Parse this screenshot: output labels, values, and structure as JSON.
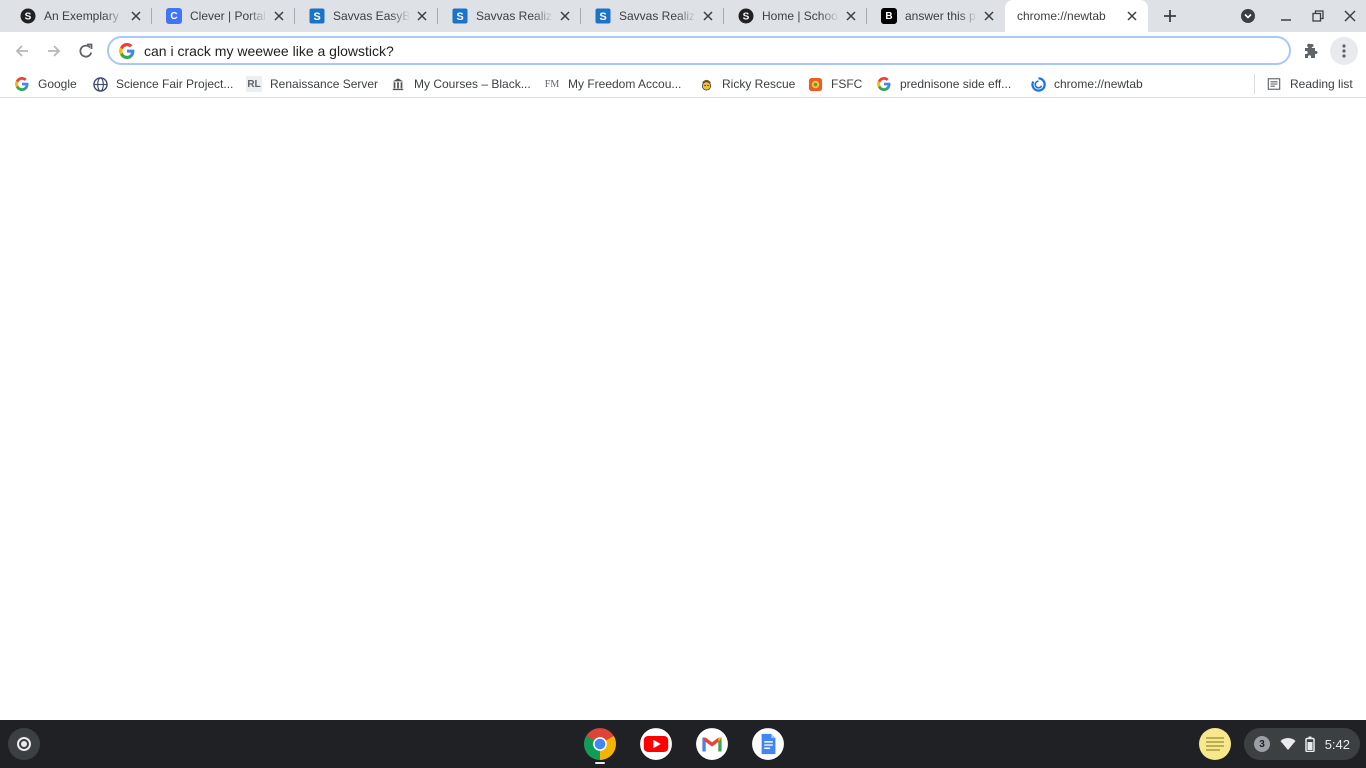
{
  "browser": {
    "tabs": [
      {
        "title": "An Exemplary",
        "favicon": "s-circle-icon"
      },
      {
        "title": "Clever | Portal",
        "favicon": "clever-c-icon"
      },
      {
        "title": "Savvas EasyBridge",
        "favicon": "savvas-s-icon"
      },
      {
        "title": "Savvas Realize",
        "favicon": "savvas-s-icon"
      },
      {
        "title": "Savvas Realize",
        "favicon": "savvas-s-icon"
      },
      {
        "title": "Home | Schoology",
        "favicon": "s-circle-icon"
      },
      {
        "title": "answer this ple",
        "favicon": "brainly-b-icon"
      },
      {
        "title": "chrome://newtab",
        "favicon": "none"
      }
    ],
    "active_tab_index": 7,
    "omnibox": {
      "value": "can i crack my weewee like a glowstick?"
    },
    "bookmarks": [
      {
        "label": "Google",
        "icon": "google-g-icon"
      },
      {
        "label": "Science Fair Project...",
        "icon": "globe-icon"
      },
      {
        "label": "Renaissance Server",
        "icon": "rl-icon"
      },
      {
        "label": "My Courses – Black...",
        "icon": "columns-icon"
      },
      {
        "label": "My Freedom Accou...",
        "icon": "fm-icon"
      },
      {
        "label": "Ricky Rescue",
        "icon": "ricky-icon"
      },
      {
        "label": "FSFC",
        "icon": "fsfc-icon"
      },
      {
        "label": "prednisone side eff...",
        "icon": "google-g-icon"
      },
      {
        "label": "chrome://newtab",
        "icon": "chrome-spinner-icon"
      }
    ],
    "reading_list": {
      "label": "Reading list"
    }
  },
  "shelf": {
    "apps": [
      "Chrome",
      "YouTube",
      "Gmail",
      "Docs"
    ],
    "notification_count": "3",
    "time": "5:42"
  },
  "colors": {
    "tab_strip": "#dee1e6",
    "shelf": "#202124",
    "omnibox_focus": "#a8c7fa"
  }
}
